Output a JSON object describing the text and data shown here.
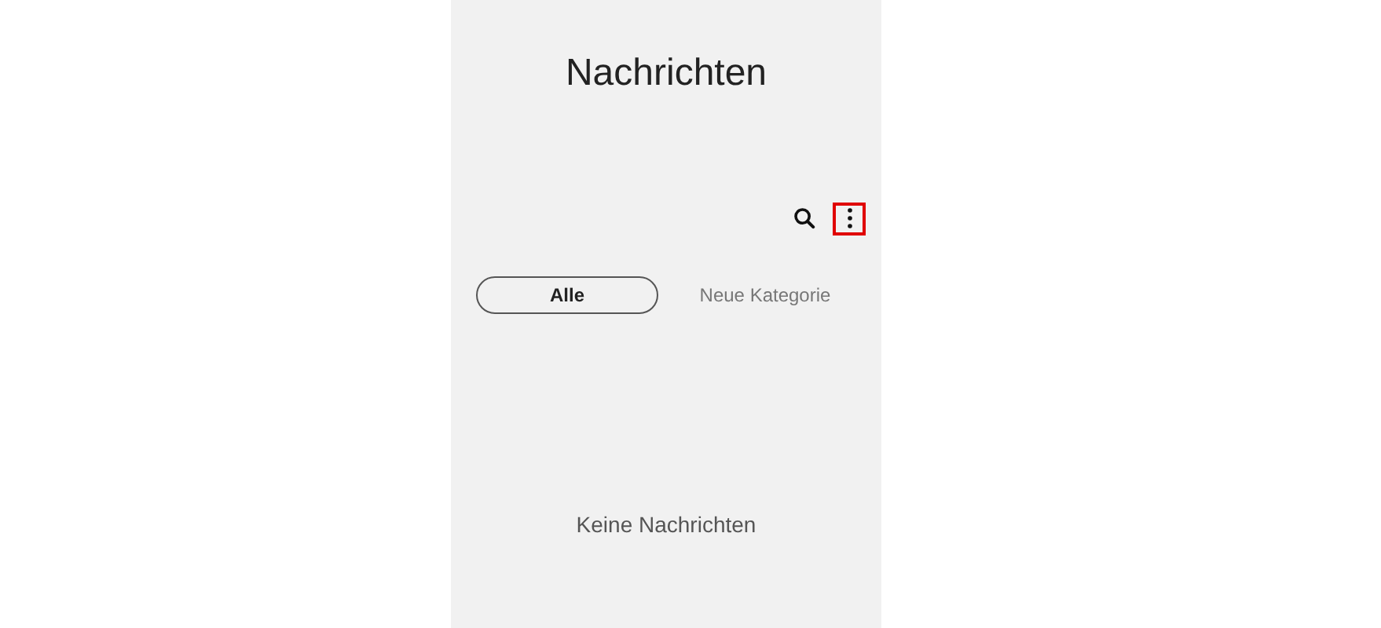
{
  "header": {
    "title": "Nachrichten"
  },
  "actions": [
    {
      "kind": "search",
      "highlighted": false
    },
    {
      "kind": "more",
      "highlighted": true
    }
  ],
  "categories": [
    {
      "label": "Alle",
      "selected": true
    },
    {
      "label": "Neue Kategorie",
      "selected": false
    }
  ],
  "empty_state": {
    "text": "Keine Nachrichten"
  }
}
